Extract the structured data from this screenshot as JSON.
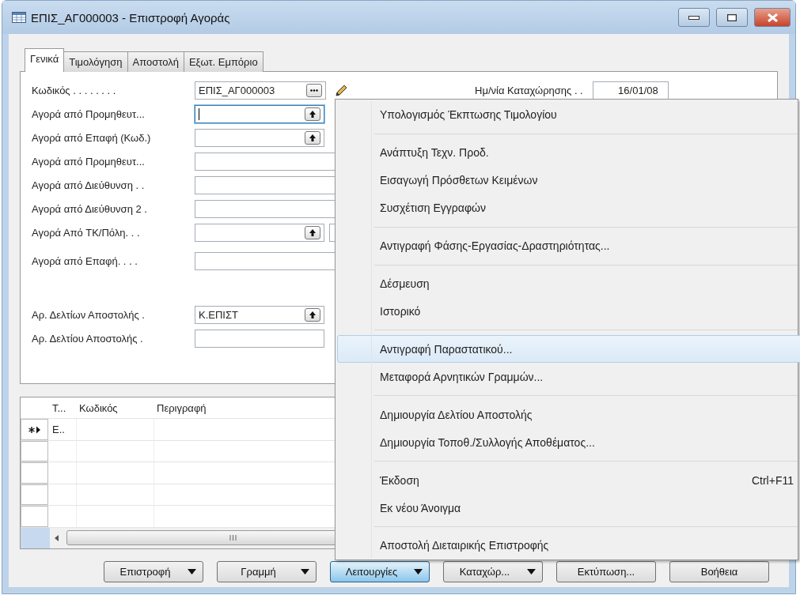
{
  "window": {
    "title": "ΕΠΙΣ_ΑΓ000003 - Επιστροφή Αγοράς"
  },
  "tabs": [
    {
      "label": "Γενικά",
      "selected": true
    },
    {
      "label": "Τιμολόγηση",
      "selected": false
    },
    {
      "label": "Αποστολή",
      "selected": false
    },
    {
      "label": "Εξωτ. Εμπόριο",
      "selected": false
    }
  ],
  "form": {
    "field_groups": [
      [
        {
          "kind": "ellipsis",
          "label": "Κωδικός . . . . . . . .",
          "value": "ΕΠΙΣ_ΑΓ000003",
          "focused": false
        },
        {
          "kind": "lookup",
          "label": "Αγορά από Προμηθευτ...",
          "focused": true
        },
        {
          "kind": "lookup",
          "label": "Αγορά από Επαφή (Κωδ.)",
          "focused": false
        },
        {
          "kind": "plain",
          "label": "Αγορά από Προμηθευτ...",
          "focused": false
        },
        {
          "kind": "plain",
          "label": "Αγορά από Διεύθυνση . .",
          "focused": false
        },
        {
          "kind": "plain",
          "label": "Αγορά από Διεύθυνση 2 .",
          "focused": false
        },
        {
          "kind": "pair",
          "label": "Αγορά Από ΤΚ/Πόλη. . .",
          "focused": false
        },
        {
          "kind": "plain",
          "label": "Αγορά από Επαφή. . . .",
          "focused": false
        }
      ],
      [
        {
          "kind": "lookup",
          "label": "Αρ. Δελτίων Αποστολής .",
          "value": "Κ.ΕΠΙΣΤ",
          "focused": false
        },
        {
          "kind": "short",
          "label": "Αρ. Δελτίου Αποστολής .",
          "focused": false
        }
      ]
    ],
    "date_field": {
      "label": "Ημ/νία Καταχώρησης . .",
      "value": "16/01/08"
    }
  },
  "lines": {
    "columns": [
      "Τ...",
      "Κωδικός",
      "Περιγραφή"
    ],
    "rows": [
      {
        "current": true,
        "cells": [
          "Ε.."
        ]
      },
      {
        "current": false
      },
      {
        "current": false
      },
      {
        "current": false
      },
      {
        "current": false
      }
    ]
  },
  "menu": {
    "groups": [
      [
        {
          "label": "Υπολογισμός Έκπτωσης Τιμολογίου",
          "selected": false
        }
      ],
      [
        {
          "label": "Ανάπτυξη Τεχν. Προδ.",
          "selected": false
        },
        {
          "label": "Εισαγωγή Πρόσθετων Κειμένων",
          "selected": false
        },
        {
          "label": "Συσχέτιση Εγγραφών",
          "selected": false
        }
      ],
      [
        {
          "label": "Αντιγραφή Φάσης-Εργασίας-Δραστηριότητας...",
          "selected": false
        }
      ],
      [
        {
          "label": "Δέσμευση",
          "selected": false
        },
        {
          "label": "Ιστορικό",
          "selected": false
        }
      ],
      [
        {
          "label": "Αντιγραφή Παραστατικού...",
          "selected": true
        },
        {
          "label": "Μεταφορά Αρνητικών Γραμμών...",
          "selected": false
        }
      ],
      [
        {
          "label": "Δημιουργία Δελτίου Αποστολής",
          "selected": false
        },
        {
          "label": "Δημιουργία Τοποθ./Συλλογής Αποθέματος...",
          "selected": false
        }
      ],
      [
        {
          "label": "Έκδοση",
          "selected": false,
          "shortcut": "Ctrl+F11"
        },
        {
          "label": "Εκ νέου Άνοιγμα",
          "selected": false
        }
      ],
      [
        {
          "label": "Αποστολή Διεταιρικής Επιστροφής",
          "selected": false
        }
      ]
    ]
  },
  "buttons": [
    {
      "label": "Επιστροφή",
      "dropdown": true,
      "pressed": false
    },
    {
      "label": "Γραμμή",
      "dropdown": true,
      "pressed": false
    },
    {
      "label": "Λειτουργίες",
      "dropdown": true,
      "pressed": true
    },
    {
      "label": "Καταχώρ...",
      "dropdown": true,
      "pressed": false
    },
    {
      "label": "Εκτύπωση...",
      "dropdown": false,
      "pressed": false
    },
    {
      "label": "Βοήθεια",
      "dropdown": false,
      "pressed": false
    }
  ]
}
